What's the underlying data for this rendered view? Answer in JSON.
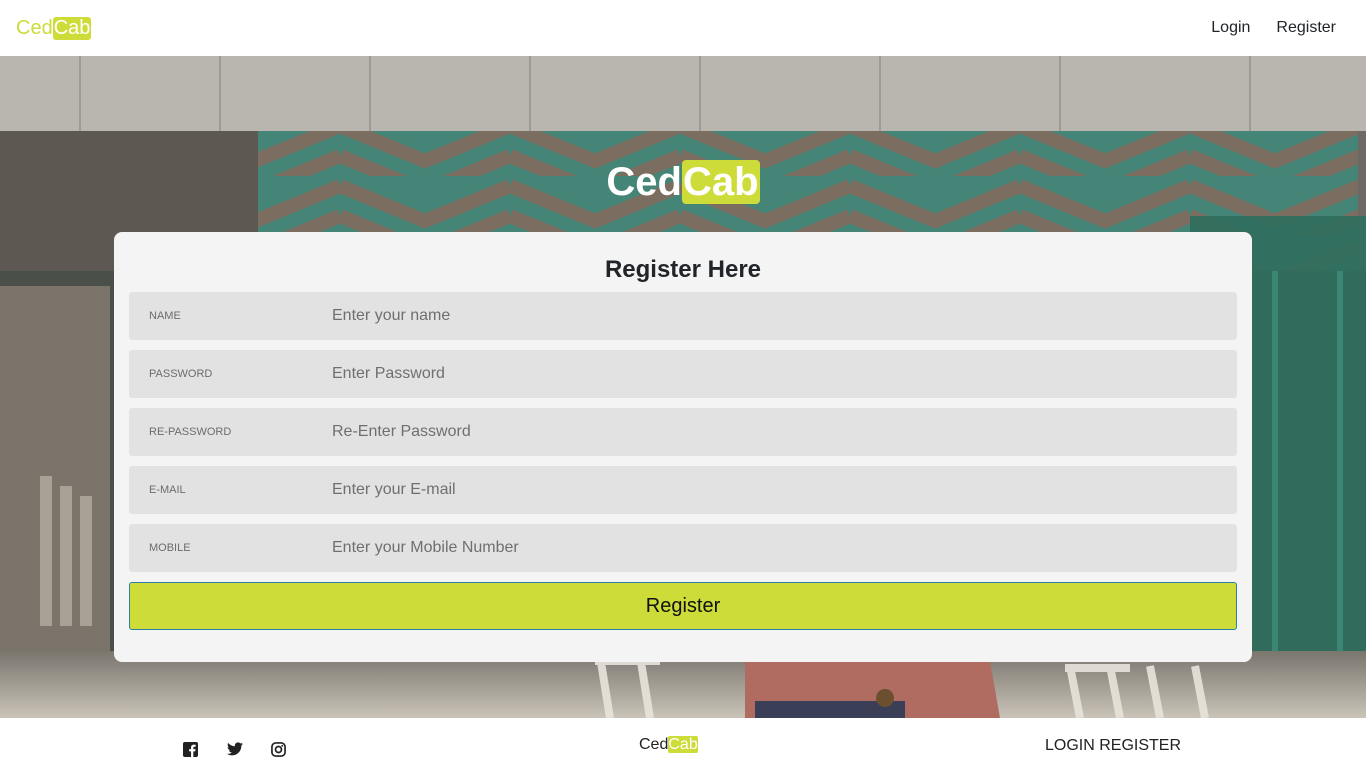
{
  "navbar": {
    "brand_part1": "Ced",
    "brand_part2": "Cab",
    "links": [
      "Login",
      "Register"
    ]
  },
  "hero": {
    "title_part1": "Ced",
    "title_part2": "Cab"
  },
  "form": {
    "title": "Register Here",
    "fields": [
      {
        "label": "NAME",
        "placeholder": "Enter your name",
        "value": ""
      },
      {
        "label": "PASSWORD",
        "placeholder": "Enter Password",
        "value": ""
      },
      {
        "label": "RE-PASSWORD",
        "placeholder": "Re-Enter Password",
        "value": ""
      },
      {
        "label": "E-MAIL",
        "placeholder": "Enter your E-mail",
        "value": ""
      },
      {
        "label": "MOBILE",
        "placeholder": "Enter your Mobile Number",
        "value": ""
      }
    ],
    "submit_label": "Register"
  },
  "footer": {
    "social_icons": [
      "facebook-icon",
      "twitter-icon",
      "instagram-icon"
    ],
    "brand_part1": "Ced",
    "brand_part2": "Cab",
    "links_text": "LOGIN REGISTER"
  },
  "colors": {
    "accent": "#cddc39",
    "card_bg": "#f4f4f4",
    "field_bg": "#e2e2e2",
    "button_border": "#2b7fa8"
  }
}
